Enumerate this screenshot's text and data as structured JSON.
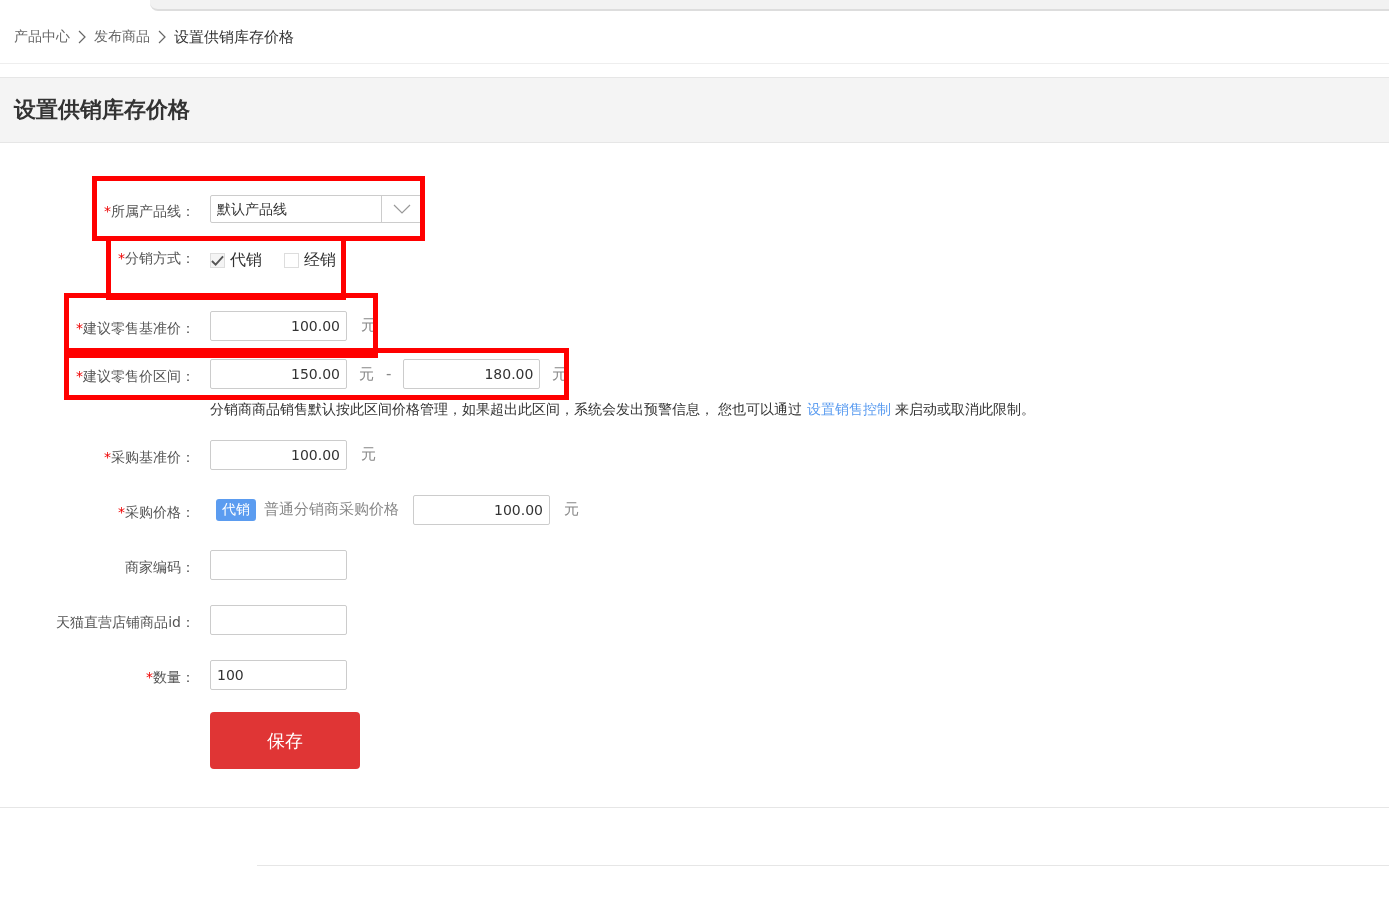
{
  "breadcrumb": [
    {
      "label": "产品中心",
      "current": false
    },
    {
      "label": "发布商品",
      "current": false
    },
    {
      "label": "设置供销库存价格",
      "current": true
    }
  ],
  "page_title": "设置供销库存价格",
  "form": [
    {
      "kind": "select",
      "required_mark": "*",
      "label": "所属产品线：",
      "highlighted": true,
      "value": "默认产品线"
    },
    {
      "kind": "checkboxes",
      "required_mark": "*",
      "label": "分销方式：",
      "highlighted": true,
      "options": [
        {
          "label": "代销",
          "checked": true
        },
        {
          "label": "经销",
          "checked": false
        }
      ]
    },
    {
      "kind": "price",
      "required_mark": "*",
      "label": "建议零售基准价：",
      "highlighted": true,
      "value": "100.00",
      "unit": "元"
    },
    {
      "kind": "range",
      "required_mark": "*",
      "label": "建议零售价区间：",
      "highlighted": true,
      "min": "150.00",
      "min_unit": "元",
      "separator": "-",
      "max": "180.00",
      "max_unit": "元",
      "hint": "分销商商品销售默认按此区间价格管理，如果超出此区间，系统会发出预警信息， 您也可以通过",
      "hint_link": "设置销售控制",
      "hint_after": "来启动或取消此限制。"
    },
    {
      "kind": "price",
      "required_mark": "*",
      "label": "采购基准价：",
      "highlighted": false,
      "value": "100.00",
      "unit": "元"
    },
    {
      "kind": "tagged_price",
      "required_mark": "*",
      "label": "采购价格：",
      "highlighted": false,
      "tag": "代销",
      "caption": "普通分销商采购价格",
      "value": "100.00",
      "unit": "元"
    },
    {
      "kind": "text",
      "label": "商家编码：",
      "highlighted": false
    },
    {
      "kind": "text",
      "label": "天猫直营店铺商品id：",
      "highlighted": false
    },
    {
      "kind": "text",
      "required_mark": "*",
      "label": "数量：",
      "highlighted": false,
      "value": "100"
    }
  ],
  "save_button": "保存"
}
